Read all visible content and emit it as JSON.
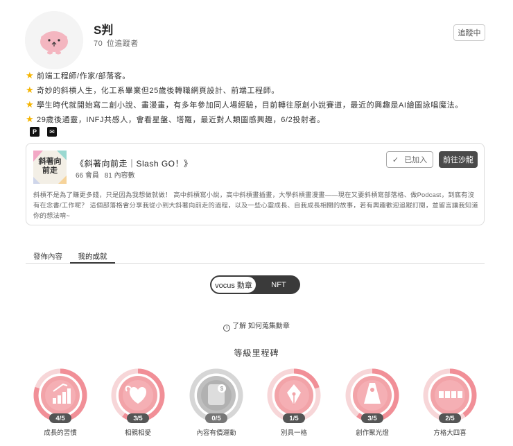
{
  "profile": {
    "name": "S判",
    "followers_count": "70",
    "followers_label": "位追蹤者",
    "follow_button": "追蹤中",
    "bio": [
      "前端工程師/作家/部落客。",
      "奇妙的斜槓人生，化工系畢業但25歲後轉職網頁設計、前端工程師。",
      "學生時代就開始寫二創小說、畫漫畫，有多年參加同人場經驗，目前轉往原創小說賽道，最近的興趣是AI繪圖詠唱魔法。",
      "29歲後通靈，INFJ共感人，會看星盤、塔羅，最近對人類圖感興趣，6/2投射者。"
    ],
    "links": [
      {
        "icon": "p-icon",
        "glyph": "P"
      },
      {
        "icon": "mail-icon",
        "glyph": "✉"
      }
    ]
  },
  "publication": {
    "title": "《斜著向前走｜Slash GO！》",
    "members": "66 會員",
    "posts": "81 內容數",
    "joined_label": "已加入",
    "go_label": "前往沙龍",
    "thumb_text": "斜著向前走",
    "description": "斜槓不是為了賺更多錢，只是因為我想做就做！ 高中斜槓寫小說，高中斜槓畫插畫，大學斜槓畫漫畫——現在又要斜槓寫部落格、做Podcast，到底有沒有在念書/工作呢？ 這個部落格會分享我從小到大斜著向前走的過程，以及一些心靈成長、自我成長相關的故事，若有興趣歡迎追蹤訂閱，並留言讓我知道你的想法唷~"
  },
  "tabs": [
    {
      "label": "發佈內容",
      "active": false
    },
    {
      "label": "我的成就",
      "active": true
    }
  ],
  "toggle": {
    "left": "vocus 勳章",
    "right": "NFT"
  },
  "learn_link": "了解 如何蒐集勳章",
  "levels_title": "等級里程碑",
  "badges": [
    {
      "name": "成長的習慣",
      "level": "4/5",
      "progress": 0.8,
      "icon": "chart-icon",
      "color": "#f2a3a8"
    },
    {
      "name": "相親相愛",
      "level": "3/5",
      "progress": 0.6,
      "icon": "hearts-icon",
      "color": "#f2a3a8"
    },
    {
      "name": "內容有價運動",
      "level": "0/5",
      "progress": 0.0,
      "icon": "coin-icon",
      "color": "#aaaaaa"
    },
    {
      "name": "別具一格",
      "level": "1/5",
      "progress": 0.2,
      "icon": "pen-nib-icon",
      "color": "#f2a3a8"
    },
    {
      "name": "創作聚光燈",
      "level": "3/5",
      "progress": 0.6,
      "icon": "spotlight-icon",
      "color": "#f2a3a8"
    },
    {
      "name": "方格大四喜",
      "level": "2/5",
      "progress": 0.4,
      "icon": "tiles-icon",
      "color": "#f2a3a8"
    }
  ]
}
